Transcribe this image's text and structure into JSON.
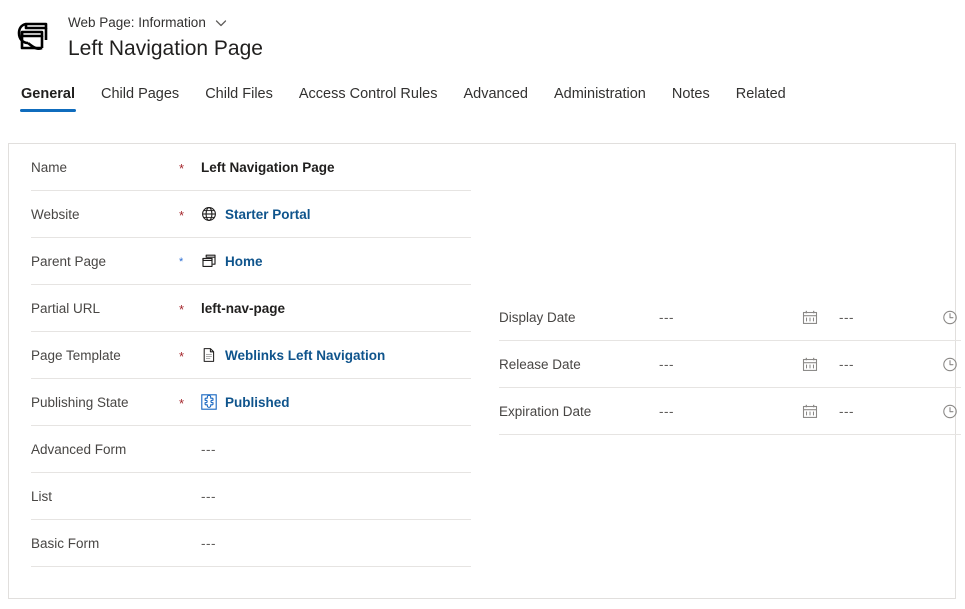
{
  "header": {
    "logo_icon": "web-page-icon",
    "entity_label": "Web Page: Information",
    "chevron_icon": "chevron-down-icon",
    "record_title": "Left Navigation Page"
  },
  "tabs": [
    {
      "label": "General",
      "active": true
    },
    {
      "label": "Child Pages",
      "active": false
    },
    {
      "label": "Child Files",
      "active": false
    },
    {
      "label": "Access Control Rules",
      "active": false
    },
    {
      "label": "Advanced",
      "active": false
    },
    {
      "label": "Administration",
      "active": false
    },
    {
      "label": "Notes",
      "active": false
    },
    {
      "label": "Related",
      "active": false
    }
  ],
  "colors": {
    "accent": "#0f6cbd",
    "link": "#0f548c",
    "required_asterisk": "#a4262c",
    "recommended_asterisk": "#2b6ed4",
    "separator": "#e6e4e2",
    "card_border": "#e1dfdd"
  },
  "form": {
    "left_column": [
      {
        "label": "Name",
        "requirement": "required",
        "requirement_mark": "*",
        "value": "Left Navigation Page",
        "value_type": "text",
        "icon": null
      },
      {
        "label": "Website",
        "requirement": "required",
        "requirement_mark": "*",
        "value": "Starter Portal",
        "value_type": "lookup",
        "icon": "globe-icon"
      },
      {
        "label": "Parent Page",
        "requirement": "recommended",
        "requirement_mark": "*",
        "value": "Home",
        "value_type": "lookup",
        "icon": "web-page-icon"
      },
      {
        "label": "Partial URL",
        "requirement": "required",
        "requirement_mark": "*",
        "value": "left-nav-page",
        "value_type": "text",
        "icon": null
      },
      {
        "label": "Page Template",
        "requirement": "required",
        "requirement_mark": "*",
        "value": "Weblinks Left Navigation",
        "value_type": "lookup",
        "icon": "document-icon"
      },
      {
        "label": "Publishing State",
        "requirement": "required",
        "requirement_mark": "*",
        "value": "Published",
        "value_type": "lookup",
        "icon": "puzzle-piece-icon"
      },
      {
        "label": "Advanced Form",
        "requirement": "none",
        "requirement_mark": "",
        "value": "---",
        "value_type": "empty",
        "icon": null
      },
      {
        "label": "List",
        "requirement": "none",
        "requirement_mark": "",
        "value": "---",
        "value_type": "empty",
        "icon": null
      },
      {
        "label": "Basic Form",
        "requirement": "none",
        "requirement_mark": "",
        "value": "---",
        "value_type": "empty",
        "icon": null
      }
    ],
    "right_column": [
      {
        "label": "Display Date",
        "date_value": "---",
        "date_icon": "calendar-icon",
        "time_value": "---",
        "time_icon": "clock-icon"
      },
      {
        "label": "Release Date",
        "date_value": "---",
        "date_icon": "calendar-icon",
        "time_value": "---",
        "time_icon": "clock-icon"
      },
      {
        "label": "Expiration Date",
        "date_value": "---",
        "date_icon": "calendar-icon",
        "time_value": "---",
        "time_icon": "clock-icon"
      }
    ]
  }
}
